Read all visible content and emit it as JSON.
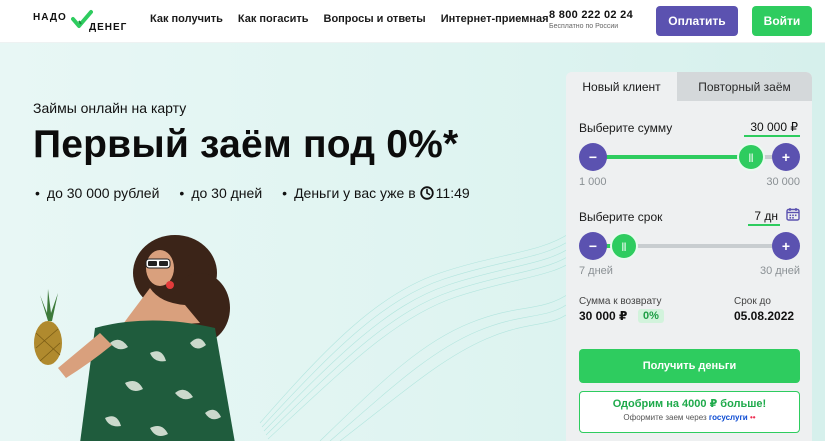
{
  "header": {
    "logo_word1": "НАДО",
    "logo_word2": "ДЕНЕГ",
    "nav": [
      "Как получить",
      "Как погасить",
      "Вопросы и ответы",
      "Интернет-приемная"
    ],
    "phone": "8 800 222 02 24",
    "phone_note": "Бесплатно по России",
    "pay_label": "Оплатить",
    "login_label": "Войти"
  },
  "hero": {
    "subtitle": "Займы онлайн на карту",
    "title": "Первый заём под 0%*",
    "bullets": [
      "до 30 000 рублей",
      "до 30 дней",
      "Деньги у вас уже в"
    ],
    "time": "11:49"
  },
  "calculator": {
    "tabs": [
      "Новый клиент",
      "Повторный заём"
    ],
    "amount": {
      "label": "Выберите сумму",
      "value": "30 000 ₽",
      "min": "1 000",
      "max": "30 000",
      "level": 0.87
    },
    "term": {
      "label": "Выберите срок",
      "value": "7 дн",
      "min": "7 дней",
      "max": "30 дней",
      "level": 0.1
    },
    "summary": {
      "return_label": "Сумма к возврату",
      "return_value": "30 000 ₽",
      "percent": "0%",
      "due_label": "Срок до",
      "due_value": "05.08.2022"
    },
    "submit_label": "Получить деньги",
    "promo_title": "Одобрим на 4000 ₽ больше!",
    "promo_sub": "Оформите заем через",
    "promo_brand": "госуслуги",
    "promo_brand_dots": "••"
  },
  "colors": {
    "accent_green": "#2ecc5f",
    "accent_purple": "#5b52b0",
    "hero_bg": "#dff4f1"
  },
  "icons": {
    "logo": "check-icon",
    "time": "clock-icon",
    "term": "calendar-icon",
    "minus": "minus-icon",
    "plus": "plus-icon"
  }
}
